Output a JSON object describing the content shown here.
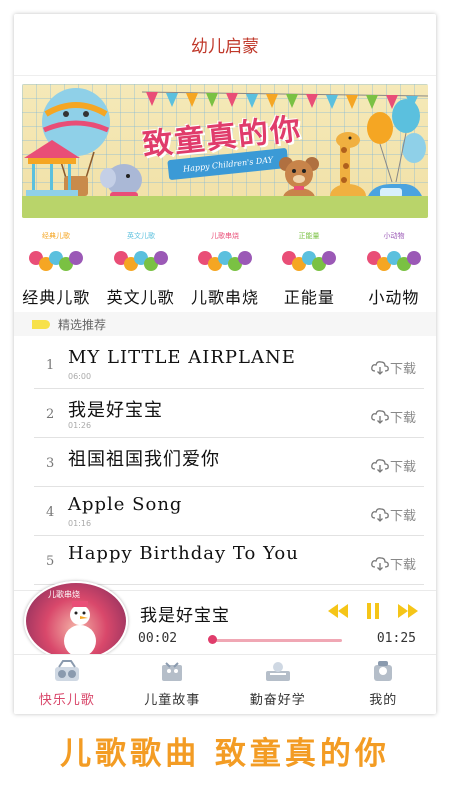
{
  "app": {
    "title": "幼儿启蒙"
  },
  "banner": {
    "headline": "致童真的你",
    "ribbon": "Happy Children's DAY"
  },
  "categories": [
    {
      "label": "经典儿歌",
      "tag": "经典儿歌",
      "color": "#f5a623"
    },
    {
      "label": "英文儿歌",
      "tag": "英文儿歌",
      "color": "#5bc0de"
    },
    {
      "label": "儿歌串烧",
      "tag": "儿歌串烧",
      "color": "#e94e77"
    },
    {
      "label": "正能量",
      "tag": "正能量",
      "color": "#7ac143"
    },
    {
      "label": "小动物",
      "tag": "小动物",
      "color": "#9b59b6"
    }
  ],
  "featured": {
    "heading": "精选推荐"
  },
  "songs": [
    {
      "num": "1",
      "name": "MY LITTLE AIRPLANE",
      "meta": "06:00",
      "download": "下载"
    },
    {
      "num": "2",
      "name": "我是好宝宝",
      "meta": "01:26",
      "download": "下载"
    },
    {
      "num": "3",
      "name": "祖国祖国我们爱你",
      "meta": "",
      "download": "下载"
    },
    {
      "num": "4",
      "name": "Apple Song",
      "meta": "01:16",
      "download": "下载"
    },
    {
      "num": "5",
      "name": "Happy Birthday To You",
      "meta": "",
      "download": "下载"
    }
  ],
  "player": {
    "cover_caption": "儿歌串烧",
    "title": "我是好宝宝",
    "current_time": "00:02",
    "total_time": "01:25",
    "progress": 0.02
  },
  "nav": [
    {
      "label": "快乐儿歌",
      "icon": "music-kids-icon",
      "active": true
    },
    {
      "label": "儿童故事",
      "icon": "story-icon",
      "active": false
    },
    {
      "label": "勤奋好学",
      "icon": "study-icon",
      "active": false
    },
    {
      "label": "我的",
      "icon": "profile-icon",
      "active": false
    }
  ],
  "slogan": "儿歌歌曲 致童真的你",
  "colors": {
    "accent": "#e03c6b",
    "title": "#c0392b",
    "slogan": "#f39c24"
  }
}
